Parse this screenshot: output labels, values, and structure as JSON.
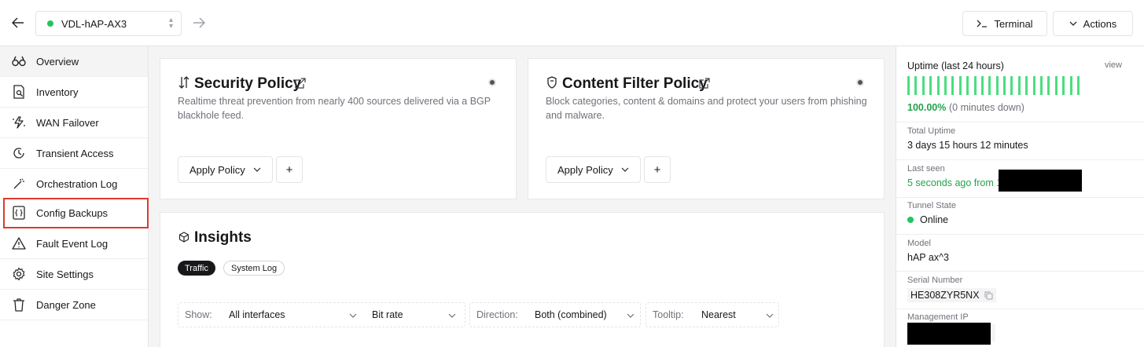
{
  "topbar": {
    "device_name": "VDL-hAP-AX3",
    "terminal_label": "Terminal",
    "actions_label": "Actions"
  },
  "sidebar": {
    "items": [
      {
        "label": "Overview",
        "icon": "binoculars-icon"
      },
      {
        "label": "Inventory",
        "icon": "document-search-icon"
      },
      {
        "label": "WAN Failover",
        "icon": "zap-failover-icon"
      },
      {
        "label": "Transient Access",
        "icon": "clock-access-icon"
      },
      {
        "label": "Orchestration Log",
        "icon": "magic-wand-icon"
      },
      {
        "label": "Config Backups",
        "icon": "braces-file-icon"
      },
      {
        "label": "Fault Event Log",
        "icon": "warning-triangle-icon"
      },
      {
        "label": "Site Settings",
        "icon": "gear-icon"
      },
      {
        "label": "Danger Zone",
        "icon": "trash-icon"
      }
    ]
  },
  "security": {
    "title": "Security Policy",
    "desc": "Realtime threat prevention from nearly 400 sources delivered via a BGP blackhole feed.",
    "apply_label": "Apply Policy",
    "plus_label": "+"
  },
  "content_filter": {
    "title": "Content Filter Policy",
    "desc": "Block categories, content & domains and protect your users from phishing and malware.",
    "apply_label": "Apply Policy",
    "plus_label": "+"
  },
  "insights": {
    "title": "Insights",
    "tabs": [
      "Traffic",
      "System Log"
    ],
    "show_label": "Show:",
    "show_value": "All interfaces",
    "rate_value": "Bit rate",
    "direction_label": "Direction:",
    "direction_value": "Both (combined)",
    "tooltip_label": "Tooltip:",
    "tooltip_value": "Nearest"
  },
  "panel": {
    "uptime_title": "Uptime (last 24 hours)",
    "view_link": "view",
    "uptime_pct": "100.00%",
    "uptime_down": "(0 minutes down)",
    "uptime_fraction": 1.0,
    "total_uptime_label": "Total Uptime",
    "total_uptime_value": "3 days 15 hours 12 minutes",
    "last_seen_label": "Last seen",
    "last_seen_value": "5 seconds ago from 1",
    "tunnel_label": "Tunnel State",
    "tunnel_value": "Online",
    "model_label": "Model",
    "model_value": "hAP ax^3",
    "serial_label": "Serial Number",
    "serial_value": "HE308ZYR5NX",
    "mgmt_label": "Management IP"
  },
  "colors": {
    "online_green": "#22c55e",
    "uptime_green": "#4ade80",
    "highlight_red": "#dc3b2f"
  }
}
